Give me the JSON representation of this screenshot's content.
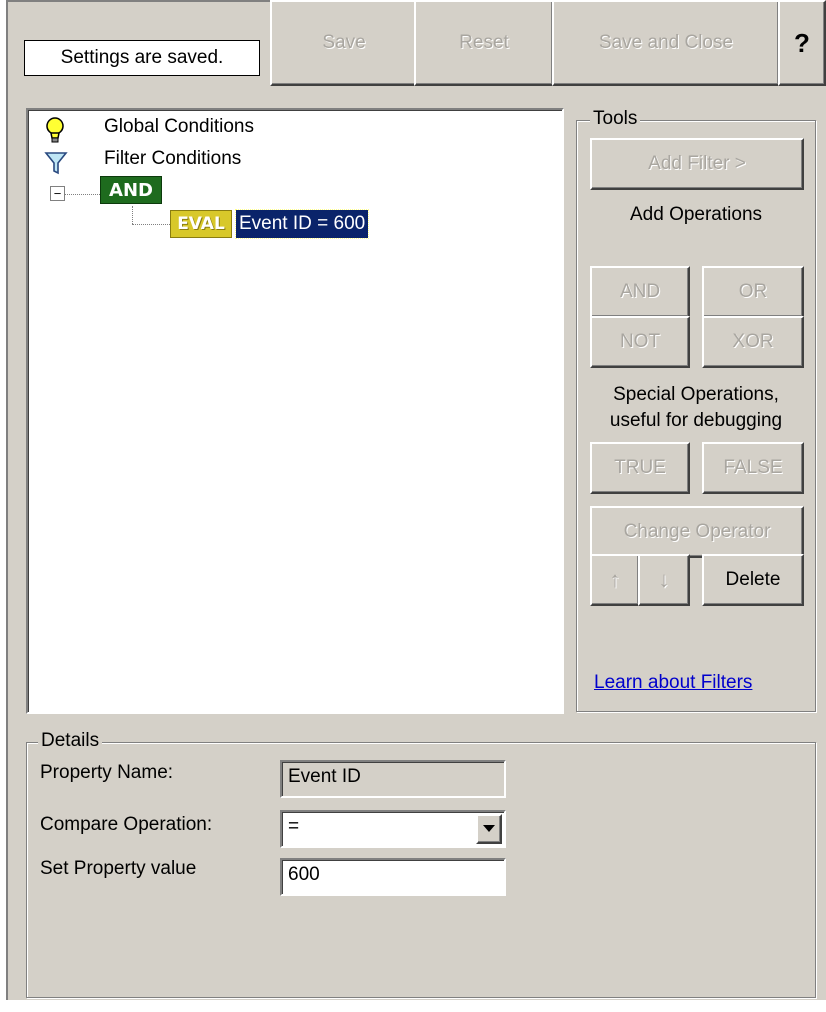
{
  "toolbar": {
    "status": "Settings are saved.",
    "save_label": "Save",
    "reset_label": "Reset",
    "save_close_label": "Save and Close",
    "help_label": "?"
  },
  "tree": {
    "items": [
      {
        "label": "Global Conditions",
        "icon": "lightbulb-icon"
      },
      {
        "label": "Filter Conditions",
        "icon": "filter-funnel-icon"
      }
    ],
    "and_badge": "AND",
    "eval_badge": "EVAL",
    "eval_label": "Event ID = 600",
    "expander": "−"
  },
  "tools": {
    "legend": "Tools",
    "add_filter": "Add Filter >",
    "add_operations": "Add Operations",
    "and": "AND",
    "or": "OR",
    "not": "NOT",
    "xor": "XOR",
    "special_line1": "Special Operations,",
    "special_line2": "useful for debugging",
    "true": "TRUE",
    "false": "FALSE",
    "change_operator": "Change Operator",
    "up_arrow": "↑",
    "down_arrow": "↓",
    "delete": "Delete",
    "learn_link": "Learn about Filters"
  },
  "details": {
    "legend": "Details",
    "property_name_label": "Property Name:",
    "property_name_value": "Event ID",
    "compare_label": "Compare Operation:",
    "compare_value": "=",
    "set_value_label": "Set Property value",
    "set_value_value": "600"
  },
  "colors": {
    "panel": "#d4d0c8",
    "and_badge": "#1e6b1e",
    "eval_badge": "#d8c82a",
    "selection": "#0a246a",
    "link": "#0000cc"
  }
}
